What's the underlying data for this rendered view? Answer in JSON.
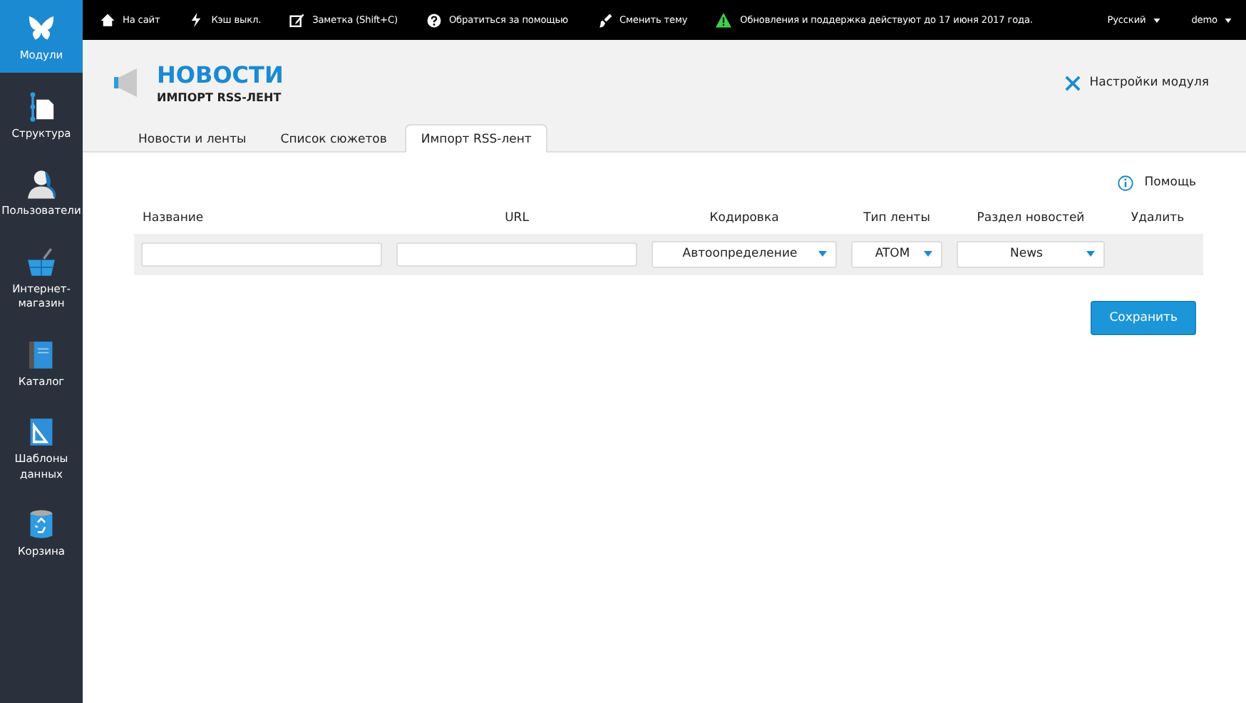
{
  "sidebar": {
    "items": [
      {
        "label": "Модули",
        "selected": true
      },
      {
        "label": "Структура",
        "selected": false
      },
      {
        "label": "Пользователи",
        "selected": false
      },
      {
        "label": "Интернет-магазин",
        "selected": false
      },
      {
        "label": "Каталог",
        "selected": false
      },
      {
        "label": "Шаблоны данных",
        "selected": false
      },
      {
        "label": "Корзина",
        "selected": false
      }
    ]
  },
  "top_bar": {
    "links": [
      "На сайт",
      "Кэш выкл.",
      "Заметка (Shift+C)",
      "Обратиться за помощью",
      "Сменить тему"
    ],
    "notice": "Обновления и поддержка действуют до 17 июня 2017 года.",
    "menus": [
      "Русский",
      "demo"
    ]
  },
  "header": {
    "title": "НОВОСТИ",
    "subtitle": "ИМПОРТ RSS-ЛЕНТ",
    "settings_link": "Настройки модуля"
  },
  "tabs": [
    {
      "label": "Новости и ленты",
      "selected": false
    },
    {
      "label": "Список сюжетов",
      "selected": false
    },
    {
      "label": "Импорт RSS-лент",
      "selected": true
    }
  ],
  "help_link": "Помощь",
  "table": {
    "columns": [
      "Название",
      "URL",
      "Кодировка",
      "Тип ленты",
      "Раздел новостей",
      "Удалить"
    ],
    "row": {
      "encoding": "Автоопределение",
      "feed_type": "ATOM",
      "section": "News"
    }
  },
  "save_button": "Сохранить"
}
